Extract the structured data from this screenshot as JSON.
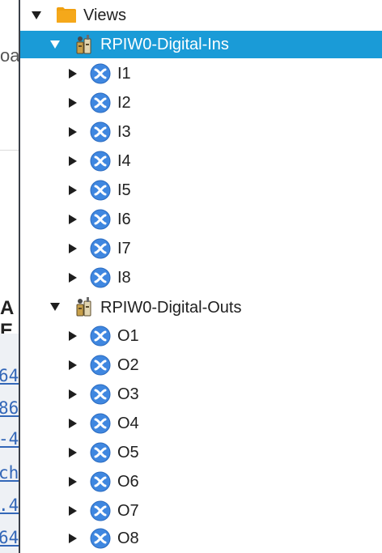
{
  "background_page": {
    "top_fragment": "oa",
    "heading_fragment": "A E",
    "code_fragments": [
      "64",
      "86",
      "-4",
      "ch",
      ".4",
      "64"
    ]
  },
  "tree": {
    "root": {
      "label": "Views",
      "icon": "folder-icon",
      "color": "#f0a010"
    },
    "groups": [
      {
        "label": "RPIW0-Digital-Ins",
        "icon": "device-icon",
        "selected": true,
        "children": [
          {
            "label": "I1",
            "icon": "node-icon"
          },
          {
            "label": "I2",
            "icon": "node-icon"
          },
          {
            "label": "I3",
            "icon": "node-icon"
          },
          {
            "label": "I4",
            "icon": "node-icon"
          },
          {
            "label": "I5",
            "icon": "node-icon"
          },
          {
            "label": "I6",
            "icon": "node-icon"
          },
          {
            "label": "I7",
            "icon": "node-icon"
          },
          {
            "label": "I8",
            "icon": "node-icon"
          }
        ]
      },
      {
        "label": "RPIW0-Digital-Outs",
        "icon": "device-icon",
        "selected": false,
        "children": [
          {
            "label": "O1",
            "icon": "node-icon"
          },
          {
            "label": "O2",
            "icon": "node-icon"
          },
          {
            "label": "O3",
            "icon": "node-icon"
          },
          {
            "label": "O4",
            "icon": "node-icon"
          },
          {
            "label": "O5",
            "icon": "node-icon"
          },
          {
            "label": "O6",
            "icon": "node-icon"
          },
          {
            "label": "O7",
            "icon": "node-icon"
          },
          {
            "label": "O8",
            "icon": "node-icon"
          }
        ]
      }
    ]
  },
  "colors": {
    "selection": "#1a9bd7",
    "node_icon": "#3f87e0",
    "folder": "#f0a010"
  }
}
